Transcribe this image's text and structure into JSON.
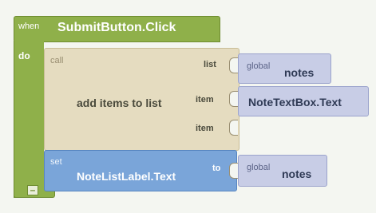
{
  "event": {
    "when_label": "when",
    "name": "SubmitButton.Click",
    "do_label": "do",
    "collapse_symbol": "–"
  },
  "call_block": {
    "call_label": "call",
    "procedure": "add items to list",
    "sockets": [
      {
        "label": "list",
        "value_prefix": "global",
        "value": "notes"
      },
      {
        "label": "item",
        "value_prefix": "",
        "value": "NoteTextBox.Text"
      },
      {
        "label": "item",
        "value_prefix": "",
        "value": ""
      }
    ]
  },
  "set_block": {
    "set_label": "set",
    "target": "NoteListLabel.Text",
    "to_label": "to",
    "value_prefix": "global",
    "value": "notes"
  },
  "colors": {
    "event": "#8fb04a",
    "call": "#e5dcc0",
    "set": "#7aa5d9",
    "value": "#c8cde6"
  }
}
